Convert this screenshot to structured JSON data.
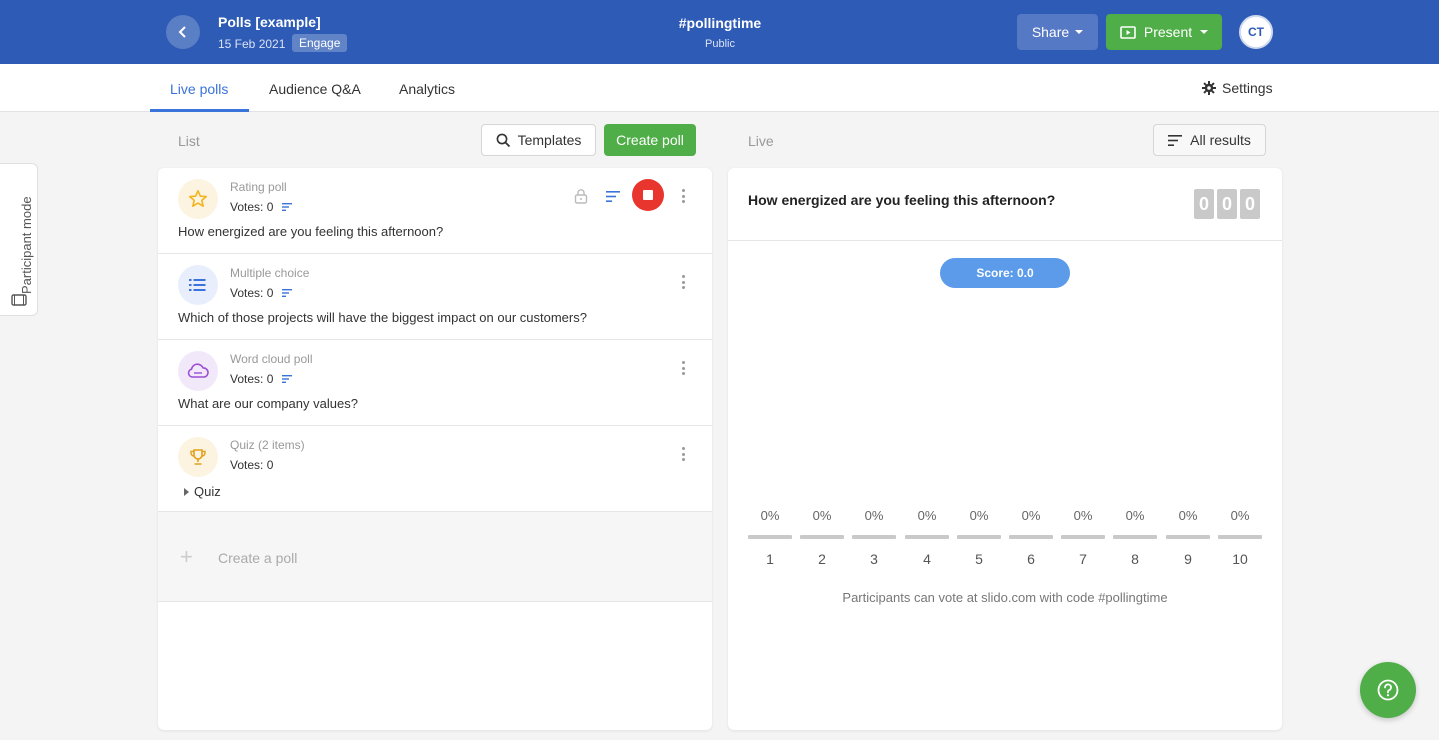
{
  "header": {
    "event_title": "Polls [example]",
    "event_date": "15 Feb 2021",
    "event_badge": "Engage",
    "event_code": "#pollingtime",
    "event_visibility": "Public",
    "share_label": "Share",
    "present_label": "Present",
    "avatar_initials": "CT",
    "bg_color": "#2d5bb5"
  },
  "tabs": [
    {
      "label": "Live polls",
      "active": true
    },
    {
      "label": "Audience Q&A",
      "active": false
    },
    {
      "label": "Analytics",
      "active": false
    }
  ],
  "settings_label": "Settings",
  "side_tab": {
    "label": "Participant mode"
  },
  "list_section": {
    "label": "List",
    "templates_label": "Templates",
    "create_label": "Create poll"
  },
  "live_section": {
    "label": "Live",
    "all_results_label": "All results"
  },
  "polls": [
    {
      "type": "Rating poll",
      "votes": "Votes: 0",
      "question": "How energized are you feeling this afternoon?",
      "icon": "star-icon",
      "active": true
    },
    {
      "type": "Multiple choice",
      "votes": "Votes: 0",
      "question": "Which of those projects will have the biggest impact on our customers?",
      "icon": "list-icon"
    },
    {
      "type": "Word cloud poll",
      "votes": "Votes: 0",
      "question": "What are our company values?",
      "icon": "cloud-icon"
    },
    {
      "type": "Quiz (2 items)",
      "votes": "Votes: 0",
      "question": "Quiz",
      "icon": "trophy-icon"
    }
  ],
  "create_row_label": "Create a poll",
  "live": {
    "question": "How energized are you feeling this afternoon?",
    "counter": [
      "0",
      "0",
      "0"
    ],
    "score_label": "Score: 0.0",
    "scale": [
      {
        "pct": "0%",
        "num": "1"
      },
      {
        "pct": "0%",
        "num": "2"
      },
      {
        "pct": "0%",
        "num": "3"
      },
      {
        "pct": "0%",
        "num": "4"
      },
      {
        "pct": "0%",
        "num": "5"
      },
      {
        "pct": "0%",
        "num": "6"
      },
      {
        "pct": "0%",
        "num": "7"
      },
      {
        "pct": "0%",
        "num": "8"
      },
      {
        "pct": "0%",
        "num": "9"
      },
      {
        "pct": "0%",
        "num": "10"
      }
    ],
    "hint": "Participants can vote at slido.com with code #pollingtime"
  },
  "colors": {
    "accent": "#3a73d9",
    "green": "#4fae47",
    "stop_red": "#e8352e"
  }
}
